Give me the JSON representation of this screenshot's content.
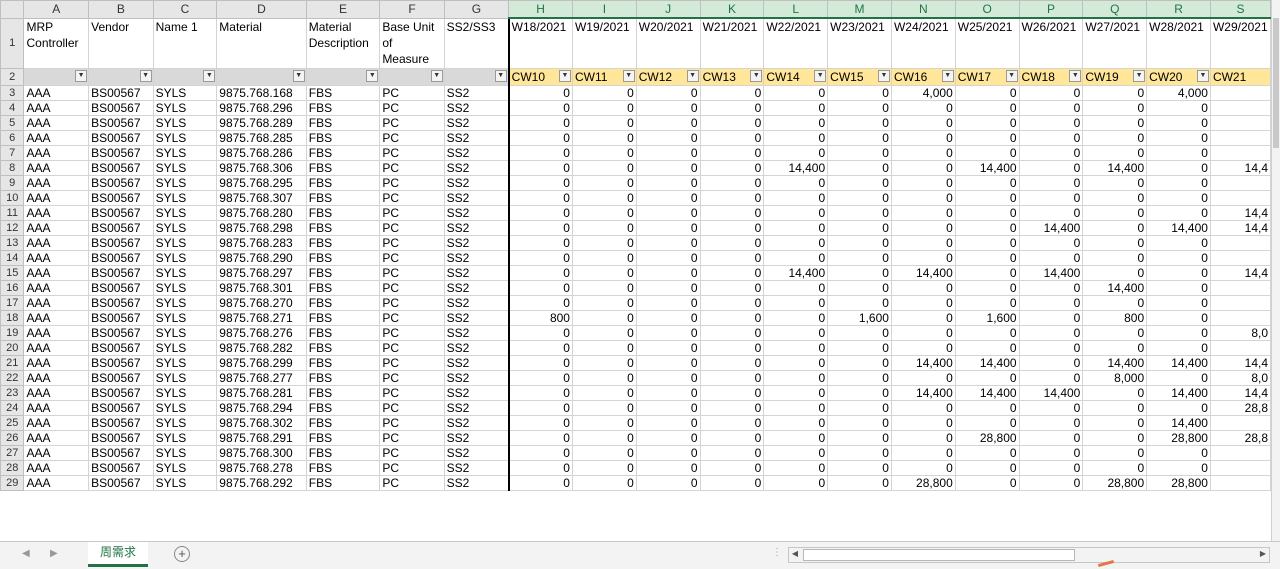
{
  "columns": [
    "A",
    "B",
    "C",
    "D",
    "E",
    "F",
    "G",
    "H",
    "I",
    "J",
    "K",
    "L",
    "M",
    "N",
    "O",
    "P",
    "Q",
    "R",
    "S"
  ],
  "header": {
    "fixed": [
      "MRP Controller",
      "Vendor",
      "Name 1",
      "Material",
      "Material Description",
      "Base Unit of Measure",
      "SS2/SS3"
    ],
    "weeks": [
      "W18/2021",
      "W19/2021",
      "W20/2021",
      "W21/2021",
      "W22/2021",
      "W23/2021",
      "W24/2021",
      "W25/2021",
      "W26/2021",
      "W27/2021",
      "W28/2021",
      "W29/2021"
    ]
  },
  "filter_row": [
    "CW10",
    "CW11",
    "CW12",
    "CW13",
    "CW14",
    "CW15",
    "CW16",
    "CW17",
    "CW18",
    "CW19",
    "CW20",
    "CW21"
  ],
  "rows": [
    {
      "n": "3",
      "m": "9875.768.168",
      "ss": "SS2",
      "v": [
        "0",
        "0",
        "0",
        "0",
        "0",
        "0",
        "4,000",
        "0",
        "0",
        "0",
        "4,000",
        ""
      ]
    },
    {
      "n": "4",
      "m": "9875.768.296",
      "ss": "SS2",
      "v": [
        "0",
        "0",
        "0",
        "0",
        "0",
        "0",
        "0",
        "0",
        "0",
        "0",
        "0",
        ""
      ]
    },
    {
      "n": "5",
      "m": "9875.768.289",
      "ss": "SS2",
      "v": [
        "0",
        "0",
        "0",
        "0",
        "0",
        "0",
        "0",
        "0",
        "0",
        "0",
        "0",
        ""
      ]
    },
    {
      "n": "6",
      "m": "9875.768.285",
      "ss": "SS2",
      "v": [
        "0",
        "0",
        "0",
        "0",
        "0",
        "0",
        "0",
        "0",
        "0",
        "0",
        "0",
        ""
      ]
    },
    {
      "n": "7",
      "m": "9875.768.286",
      "ss": "SS2",
      "v": [
        "0",
        "0",
        "0",
        "0",
        "0",
        "0",
        "0",
        "0",
        "0",
        "0",
        "0",
        ""
      ]
    },
    {
      "n": "8",
      "m": "9875.768.306",
      "ss": "SS2",
      "v": [
        "0",
        "0",
        "0",
        "0",
        "14,400",
        "0",
        "0",
        "14,400",
        "0",
        "14,400",
        "0",
        "14,4"
      ]
    },
    {
      "n": "9",
      "m": "9875.768.295",
      "ss": "SS2",
      "v": [
        "0",
        "0",
        "0",
        "0",
        "0",
        "0",
        "0",
        "0",
        "0",
        "0",
        "0",
        ""
      ]
    },
    {
      "n": "10",
      "m": "9875.768.307",
      "ss": "SS2",
      "v": [
        "0",
        "0",
        "0",
        "0",
        "0",
        "0",
        "0",
        "0",
        "0",
        "0",
        "0",
        ""
      ]
    },
    {
      "n": "11",
      "m": "9875.768.280",
      "ss": "SS2",
      "v": [
        "0",
        "0",
        "0",
        "0",
        "0",
        "0",
        "0",
        "0",
        "0",
        "0",
        "0",
        "14,4"
      ]
    },
    {
      "n": "12",
      "m": "9875.768.298",
      "ss": "SS2",
      "v": [
        "0",
        "0",
        "0",
        "0",
        "0",
        "0",
        "0",
        "0",
        "14,400",
        "0",
        "14,400",
        "14,4"
      ]
    },
    {
      "n": "13",
      "m": "9875.768.283",
      "ss": "SS2",
      "v": [
        "0",
        "0",
        "0",
        "0",
        "0",
        "0",
        "0",
        "0",
        "0",
        "0",
        "0",
        ""
      ]
    },
    {
      "n": "14",
      "m": "9875.768.290",
      "ss": "SS2",
      "v": [
        "0",
        "0",
        "0",
        "0",
        "0",
        "0",
        "0",
        "0",
        "0",
        "0",
        "0",
        ""
      ]
    },
    {
      "n": "15",
      "m": "9875.768.297",
      "ss": "SS2",
      "v": [
        "0",
        "0",
        "0",
        "0",
        "14,400",
        "0",
        "14,400",
        "0",
        "14,400",
        "0",
        "0",
        "14,4"
      ]
    },
    {
      "n": "16",
      "m": "9875.768.301",
      "ss": "SS2",
      "v": [
        "0",
        "0",
        "0",
        "0",
        "0",
        "0",
        "0",
        "0",
        "0",
        "14,400",
        "0",
        ""
      ]
    },
    {
      "n": "17",
      "m": "9875.768.270",
      "ss": "SS2",
      "v": [
        "0",
        "0",
        "0",
        "0",
        "0",
        "0",
        "0",
        "0",
        "0",
        "0",
        "0",
        ""
      ]
    },
    {
      "n": "18",
      "m": "9875.768.271",
      "ss": "SS2",
      "v": [
        "800",
        "0",
        "0",
        "0",
        "0",
        "1,600",
        "0",
        "1,600",
        "0",
        "800",
        "0",
        ""
      ]
    },
    {
      "n": "19",
      "m": "9875.768.276",
      "ss": "SS2",
      "v": [
        "0",
        "0",
        "0",
        "0",
        "0",
        "0",
        "0",
        "0",
        "0",
        "0",
        "0",
        "8,0"
      ]
    },
    {
      "n": "20",
      "m": "9875.768.282",
      "ss": "SS2",
      "v": [
        "0",
        "0",
        "0",
        "0",
        "0",
        "0",
        "0",
        "0",
        "0",
        "0",
        "0",
        ""
      ]
    },
    {
      "n": "21",
      "m": "9875.768.299",
      "ss": "SS2",
      "v": [
        "0",
        "0",
        "0",
        "0",
        "0",
        "0",
        "14,400",
        "14,400",
        "0",
        "14,400",
        "14,400",
        "14,4"
      ]
    },
    {
      "n": "22",
      "m": "9875.768.277",
      "ss": "SS2",
      "v": [
        "0",
        "0",
        "0",
        "0",
        "0",
        "0",
        "0",
        "0",
        "0",
        "8,000",
        "0",
        "8,0"
      ]
    },
    {
      "n": "23",
      "m": "9875.768.281",
      "ss": "SS2",
      "v": [
        "0",
        "0",
        "0",
        "0",
        "0",
        "0",
        "14,400",
        "14,400",
        "14,400",
        "0",
        "14,400",
        "14,4"
      ]
    },
    {
      "n": "24",
      "m": "9875.768.294",
      "ss": "SS2",
      "v": [
        "0",
        "0",
        "0",
        "0",
        "0",
        "0",
        "0",
        "0",
        "0",
        "0",
        "0",
        "28,8"
      ]
    },
    {
      "n": "25",
      "m": "9875.768.302",
      "ss": "SS2",
      "v": [
        "0",
        "0",
        "0",
        "0",
        "0",
        "0",
        "0",
        "0",
        "0",
        "0",
        "14,400",
        ""
      ]
    },
    {
      "n": "26",
      "m": "9875.768.291",
      "ss": "SS2",
      "v": [
        "0",
        "0",
        "0",
        "0",
        "0",
        "0",
        "0",
        "28,800",
        "0",
        "0",
        "28,800",
        "28,8"
      ]
    },
    {
      "n": "27",
      "m": "9875.768.300",
      "ss": "SS2",
      "v": [
        "0",
        "0",
        "0",
        "0",
        "0",
        "0",
        "0",
        "0",
        "0",
        "0",
        "0",
        ""
      ]
    },
    {
      "n": "28",
      "m": "9875.768.278",
      "ss": "SS2",
      "v": [
        "0",
        "0",
        "0",
        "0",
        "0",
        "0",
        "0",
        "0",
        "0",
        "0",
        "0",
        ""
      ]
    },
    {
      "n": "29",
      "m": "9875.768.292",
      "ss": "SS2",
      "v": [
        "0",
        "0",
        "0",
        "0",
        "0",
        "0",
        "28,800",
        "0",
        "0",
        "28,800",
        "28,800",
        ""
      ]
    }
  ],
  "common": {
    "mrp": "AAA",
    "vendor": "BS00567",
    "name1": "SYLS",
    "desc": "FBS",
    "unit": "PC"
  },
  "sheet_tab": "周需求",
  "add_sheet": "+",
  "row_labels": {
    "header": "1",
    "filter": "2"
  }
}
